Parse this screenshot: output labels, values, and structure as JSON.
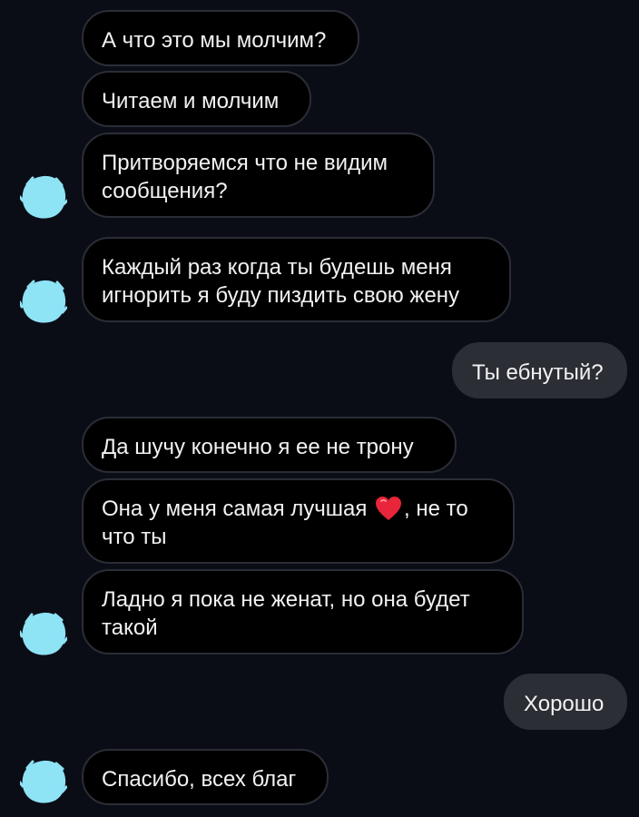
{
  "colors": {
    "background": "#0b0d16",
    "incoming_bubble": "#000000",
    "incoming_border": "#2b2d36",
    "outgoing_bubble": "#2c2e35",
    "text": "#f2f2f2",
    "avatar_scribble": "#8ee3f5",
    "heart": "#e8253a"
  },
  "messages": [
    {
      "direction": "incoming",
      "text": "А что это мы молчим?"
    },
    {
      "direction": "incoming",
      "text": "Читаем и молчим"
    },
    {
      "direction": "incoming",
      "text": "Притворяемся что не видим\nсообщения?"
    },
    {
      "direction": "incoming",
      "text": "Каждый раз когда ты будешь меня\nигнорить я буду пиздить свою жену"
    },
    {
      "direction": "outgoing",
      "text": "Ты ебнутый?"
    },
    {
      "direction": "incoming",
      "text": "Да шучу конечно я ее не трону"
    },
    {
      "direction": "incoming",
      "text_before": "Она у меня самая лучшая ",
      "emoji": "red-heart",
      "text_after": ", не то\nчто ты"
    },
    {
      "direction": "incoming",
      "text": "Ладно я пока не женат, но она будет\nтакой"
    },
    {
      "direction": "outgoing",
      "text": "Хорошо"
    },
    {
      "direction": "incoming",
      "text": "Спасибо, всех благ"
    }
  ],
  "avatars": [
    {
      "icon": "scribbled-avatar-icon"
    },
    {
      "icon": "scribbled-avatar-icon"
    },
    {
      "icon": "scribbled-avatar-icon"
    },
    {
      "icon": "scribbled-avatar-icon"
    }
  ]
}
